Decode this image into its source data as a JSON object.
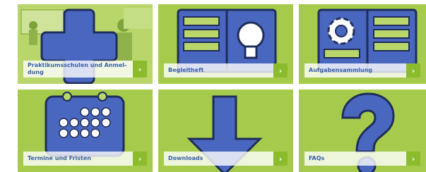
{
  "tiles": [
    {
      "label": "Praktikumsschulen und Anmel-\ndung",
      "icon": "plus-icon",
      "arrow": "›"
    },
    {
      "label": "Begleitheft",
      "icon": "lightbulb-icon",
      "arrow": "›"
    },
    {
      "label": "Aufgabensammlung",
      "icon": "gear-icon",
      "arrow": "›"
    },
    {
      "label": "Termine und Fristen",
      "icon": "calendar-icon",
      "arrow": "›"
    },
    {
      "label": "Downloads",
      "icon": "download-arrow-icon",
      "arrow": "›"
    },
    {
      "label": "FAQs",
      "icon": "question-mark-icon",
      "arrow": "›"
    }
  ],
  "colors": {
    "tile_bg": "#a6cb4c",
    "icon_fill": "#4a67c0",
    "icon_stroke": "#1f2d5a",
    "label_text": "#3a5fa7",
    "arrow_bg": "#8cbb2d"
  }
}
